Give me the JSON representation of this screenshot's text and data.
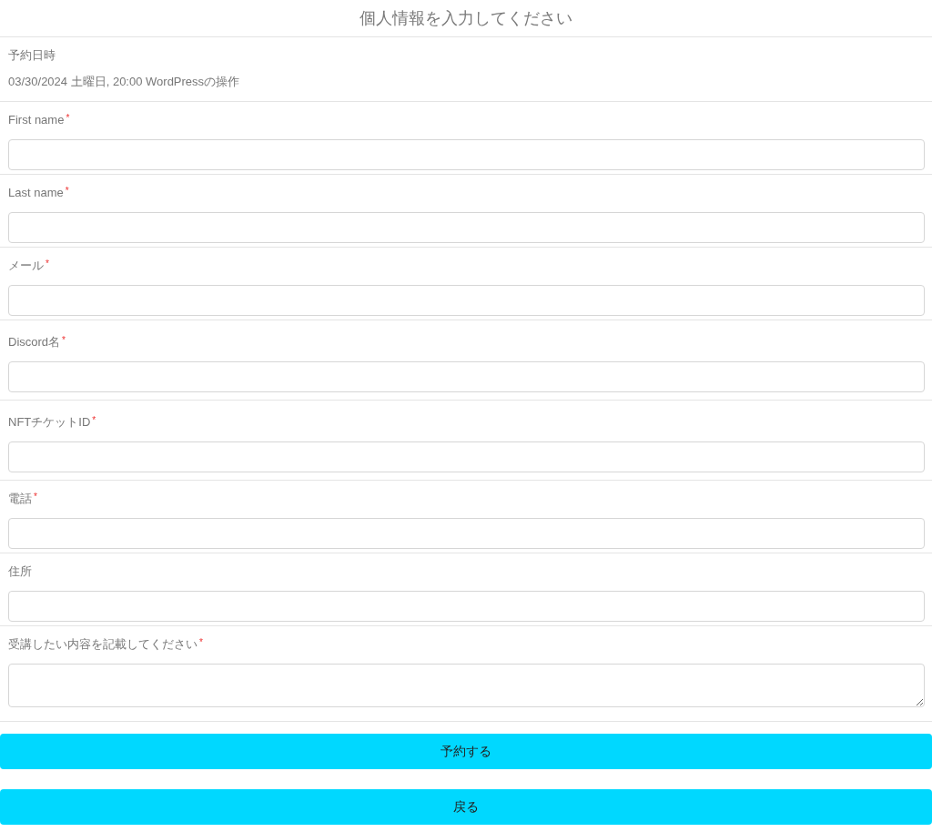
{
  "title": "個人情報を入力してください",
  "booking": {
    "label": "予約日時",
    "value": "03/30/2024 土曜日, 20:00 WordPressの操作"
  },
  "fields": [
    {
      "label": "First name",
      "required_mark": "*",
      "kind": "input"
    },
    {
      "label": "Last name",
      "required_mark": "*",
      "kind": "input"
    },
    {
      "label": "メール",
      "required_mark": "*",
      "kind": "input"
    },
    {
      "label": "Discord名",
      "required_mark": "*",
      "kind": "input"
    },
    {
      "label": "NFTチケットID",
      "required_mark": "*",
      "kind": "input"
    },
    {
      "label": "電話",
      "required_mark": "*",
      "kind": "input"
    },
    {
      "label": "住所",
      "kind": "input"
    },
    {
      "label": "受講したい内容を記載してください",
      "required_mark": "*",
      "kind": "textarea"
    }
  ],
  "buttons": [
    "予約する",
    "戻る"
  ]
}
